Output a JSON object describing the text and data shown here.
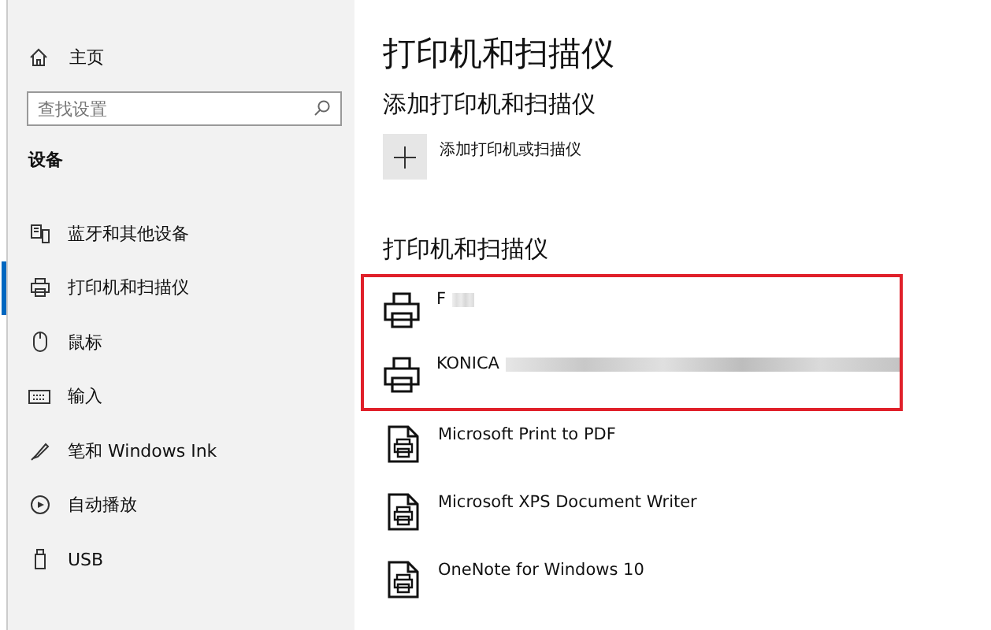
{
  "sidebar": {
    "home": {
      "label": "主页"
    },
    "search": {
      "placeholder": "查找设置"
    },
    "section": "设备",
    "items": [
      {
        "label": "蓝牙和其他设备",
        "kind": "bluetooth",
        "selected": false
      },
      {
        "label": "打印机和扫描仪",
        "kind": "printer",
        "selected": true
      },
      {
        "label": "鼠标",
        "kind": "mouse",
        "selected": false
      },
      {
        "label": "输入",
        "kind": "keyboard",
        "selected": false
      },
      {
        "label": "笔和 Windows Ink",
        "kind": "pen",
        "selected": false
      },
      {
        "label": "自动播放",
        "kind": "autoplay",
        "selected": false
      },
      {
        "label": "USB",
        "kind": "usb",
        "selected": false
      }
    ]
  },
  "main": {
    "title": "打印机和扫描仪",
    "add_section": {
      "heading": "添加打印机和扫描仪",
      "button": "添加打印机或扫描仪"
    },
    "list_heading": "打印机和扫描仪",
    "highlighted_printers": [
      {
        "name": "F",
        "redacted": true
      },
      {
        "name": "KONICA",
        "redacted": true
      }
    ],
    "printers": [
      {
        "name": "Microsoft Print to PDF"
      },
      {
        "name": "Microsoft XPS Document Writer"
      },
      {
        "name": "OneNote for Windows 10"
      }
    ]
  }
}
